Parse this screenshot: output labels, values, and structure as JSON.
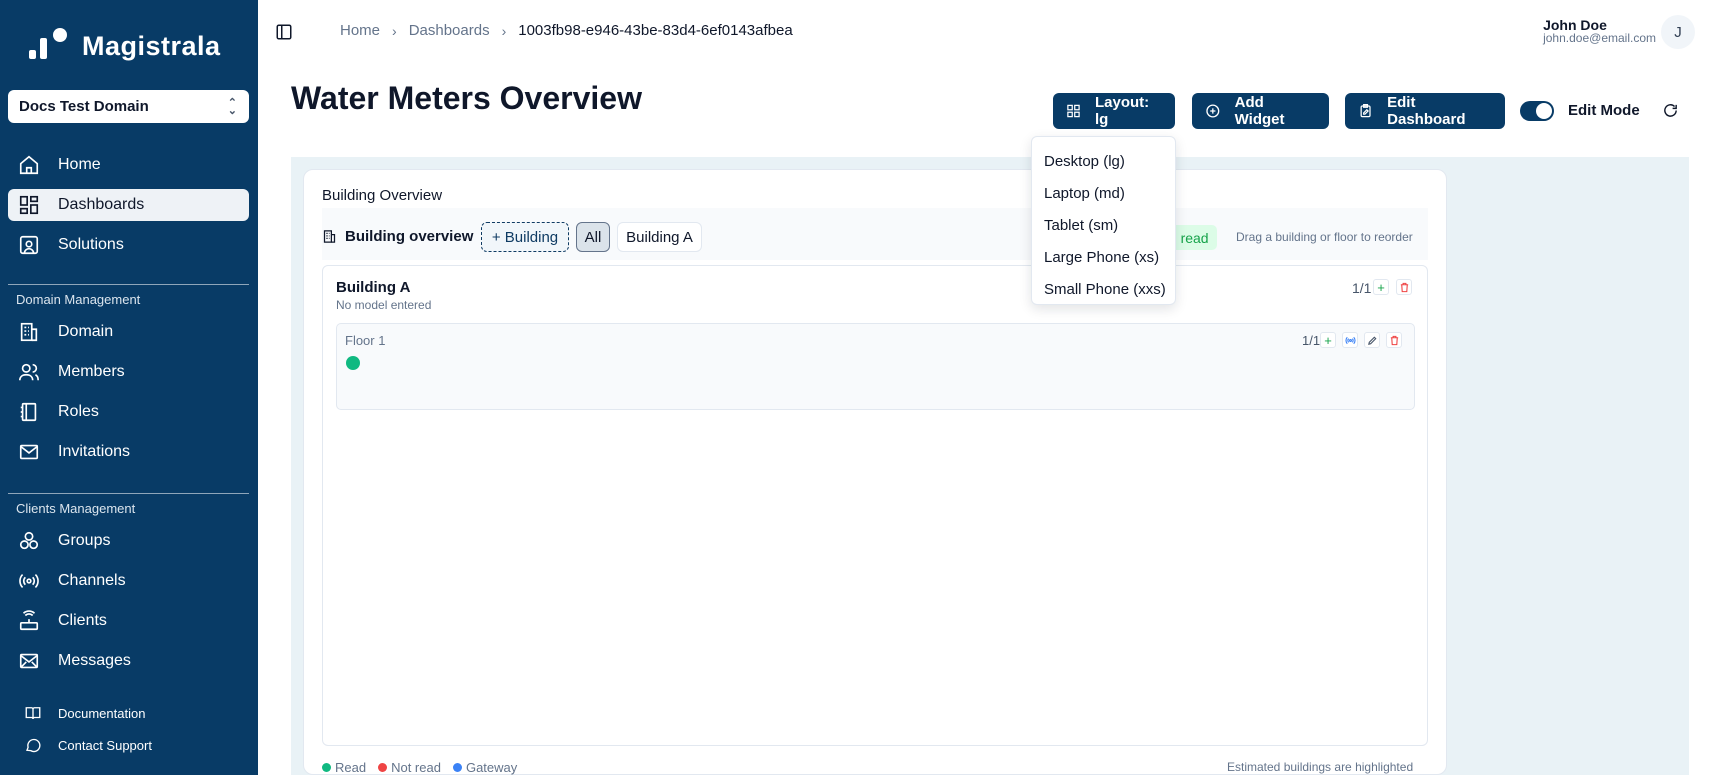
{
  "app": {
    "name": "Magistrala",
    "domain": "Docs Test Domain"
  },
  "sidebar": {
    "items": [
      {
        "label": "Home",
        "icon": "home-icon"
      },
      {
        "label": "Dashboards",
        "icon": "dashboards-icon",
        "active": true
      },
      {
        "label": "Solutions",
        "icon": "solutions-icon"
      }
    ],
    "domain_management": {
      "label": "Domain Management",
      "items": [
        {
          "label": "Domain",
          "icon": "domain-icon"
        },
        {
          "label": "Members",
          "icon": "members-icon"
        },
        {
          "label": "Roles",
          "icon": "roles-icon"
        },
        {
          "label": "Invitations",
          "icon": "invitations-icon"
        }
      ]
    },
    "clients_management": {
      "label": "Clients Management",
      "items": [
        {
          "label": "Groups",
          "icon": "groups-icon"
        },
        {
          "label": "Channels",
          "icon": "channels-icon"
        },
        {
          "label": "Clients",
          "icon": "clients-icon"
        },
        {
          "label": "Messages",
          "icon": "messages-icon"
        }
      ]
    },
    "footer": [
      {
        "label": "Documentation",
        "icon": "book-icon"
      },
      {
        "label": "Contact Support",
        "icon": "chat-icon"
      }
    ]
  },
  "header": {
    "breadcrumb": [
      "Home",
      "Dashboards",
      "1003fb98-e946-43be-83d4-6ef0143afbea"
    ],
    "user": {
      "name": "John Doe",
      "email": "john.doe@email.com",
      "initial": "J"
    }
  },
  "page": {
    "title": "Water Meters Overview",
    "buttons": {
      "layout": "Layout: lg",
      "add_widget": "Add Widget",
      "edit_dashboard": "Edit Dashboard"
    },
    "edit_mode": {
      "label": "Edit Mode",
      "on": true
    }
  },
  "layout_menu": {
    "options": [
      "Desktop (lg)",
      "Laptop (md)",
      "Tablet (sm)",
      "Large Phone (xs)",
      "Small Phone (xxs)"
    ]
  },
  "widget": {
    "title": "Building Overview",
    "toolbar": {
      "label": "Building overview",
      "add_building": "+ Building",
      "filters": [
        "All",
        "Building A"
      ],
      "read_status": "/1 read",
      "drag_hint": "Drag a building or floor to reorder"
    },
    "buildings": [
      {
        "name": "Building A",
        "model": "No model entered",
        "count": "1/1",
        "floors": [
          {
            "name": "Floor 1",
            "count": "1/1",
            "meters": [
              "read"
            ]
          }
        ]
      }
    ],
    "legend": [
      "Read",
      "Not read",
      "Gateway"
    ],
    "estimate_note": "Estimated buildings are highlighted"
  },
  "colors": {
    "sidebar_bg": "#083b66",
    "accent": "#083b66",
    "read": "#10b981",
    "not_read": "#ef4444",
    "gateway": "#3b82f6",
    "canvas_bg": "#e9f2f6"
  }
}
